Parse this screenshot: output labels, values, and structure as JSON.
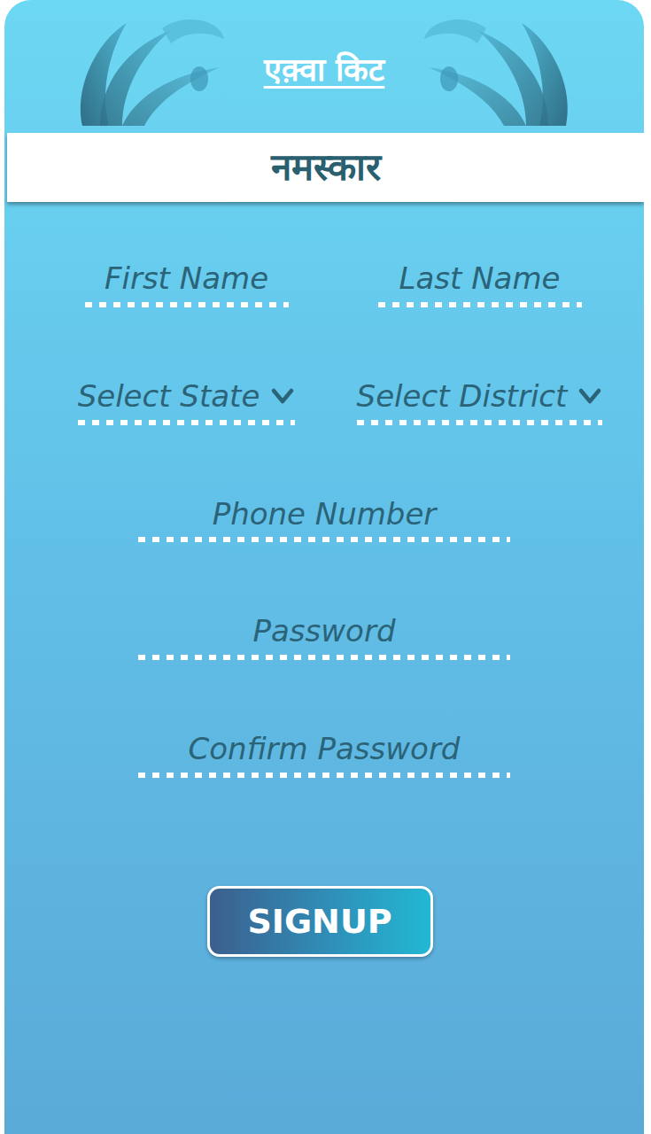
{
  "app": {
    "title": "एक़्वा किट"
  },
  "greeting": "नमस्कार",
  "form": {
    "rows": [
      [
        {
          "kind": "input",
          "label": "First Name"
        },
        {
          "kind": "input",
          "label": "Last Name"
        }
      ],
      [
        {
          "kind": "select",
          "label": "Select State"
        },
        {
          "kind": "select",
          "label": "Select District"
        }
      ],
      [
        {
          "kind": "input",
          "label": "Phone Number"
        }
      ],
      [
        {
          "kind": "input",
          "label": "Password"
        }
      ],
      [
        {
          "kind": "input",
          "label": "Confirm Password"
        }
      ]
    ]
  },
  "submit": {
    "label": "SIGNUP"
  }
}
